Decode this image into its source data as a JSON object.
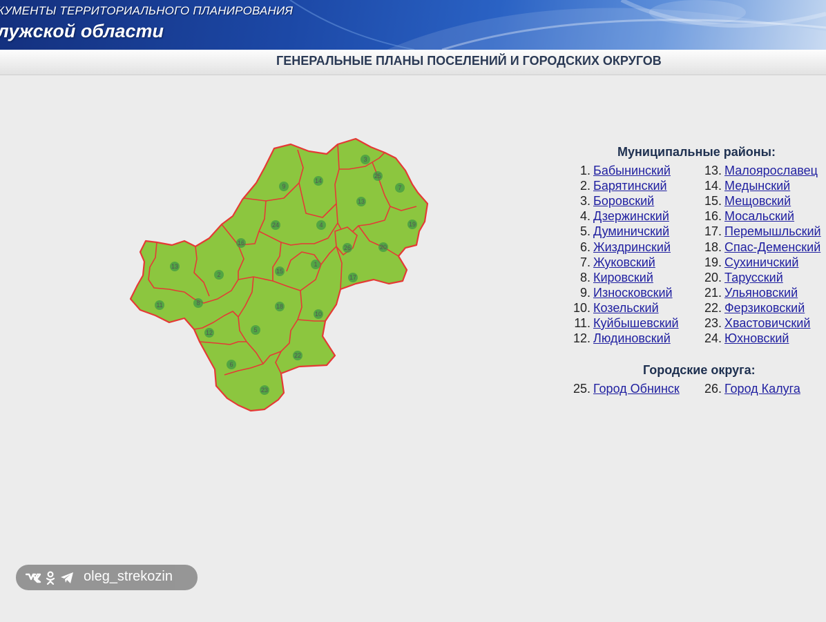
{
  "header": {
    "line1": "КУМЕНТЫ ТЕРРИТОРИАЛЬНОГО ПЛАНИРОВАНИЯ",
    "line2": "лужской области"
  },
  "subtitle": "ГЕНЕРАЛЬНЫЕ ПЛАНЫ ПОСЕЛЕНИЙ И ГОРОДСКИХ ОКРУГОВ",
  "map": {
    "fill_color": "#8cc63f",
    "border_color": "#e53935",
    "region_labels": [
      "1",
      "2",
      "3",
      "4",
      "5",
      "6",
      "7",
      "8",
      "9",
      "10",
      "11",
      "12",
      "13",
      "13",
      "14",
      "15",
      "16",
      "17",
      "18",
      "19",
      "20",
      "22",
      "23",
      "24",
      "25",
      "26",
      "27"
    ]
  },
  "districts_heading": "Муниципальные районы:",
  "districts": [
    {
      "num": "1.",
      "name": "Бабынинский"
    },
    {
      "num": "2.",
      "name": "Барятинский"
    },
    {
      "num": "3.",
      "name": "Боровский"
    },
    {
      "num": "4.",
      "name": "Дзержинский"
    },
    {
      "num": "5.",
      "name": "Думиничский"
    },
    {
      "num": "6.",
      "name": "Жиздринский"
    },
    {
      "num": "7.",
      "name": "Жуковский"
    },
    {
      "num": "8.",
      "name": "Кировский"
    },
    {
      "num": "9.",
      "name": "Износковский"
    },
    {
      "num": "10.",
      "name": "Козельский"
    },
    {
      "num": "11.",
      "name": "Куйбышевский"
    },
    {
      "num": "12.",
      "name": "Людиновский"
    },
    {
      "num": "13.",
      "name": "Малоярославец"
    },
    {
      "num": "14.",
      "name": "Медынский"
    },
    {
      "num": "15.",
      "name": "Мещовский"
    },
    {
      "num": "16.",
      "name": "Мосальский"
    },
    {
      "num": "17.",
      "name": "Перемышльский"
    },
    {
      "num": "18.",
      "name": "Спас-Деменский"
    },
    {
      "num": "19.",
      "name": "Сухиничский"
    },
    {
      "num": "20.",
      "name": "Тарусский"
    },
    {
      "num": "21.",
      "name": "Ульяновский"
    },
    {
      "num": "22.",
      "name": "Ферзиковский"
    },
    {
      "num": "23.",
      "name": "Хвастовичский"
    },
    {
      "num": "24.",
      "name": "Юхновский"
    }
  ],
  "okrugs_heading": "Городские округа:",
  "okrugs": [
    {
      "num": "25.",
      "name": "Город Обнинск"
    },
    {
      "num": "26.",
      "name": "Город Калуга"
    }
  ],
  "watermark": {
    "text": "oleg_strekozin",
    "icons": [
      "vk-icon",
      "odnoklassniki-icon",
      "telegram-icon"
    ]
  }
}
